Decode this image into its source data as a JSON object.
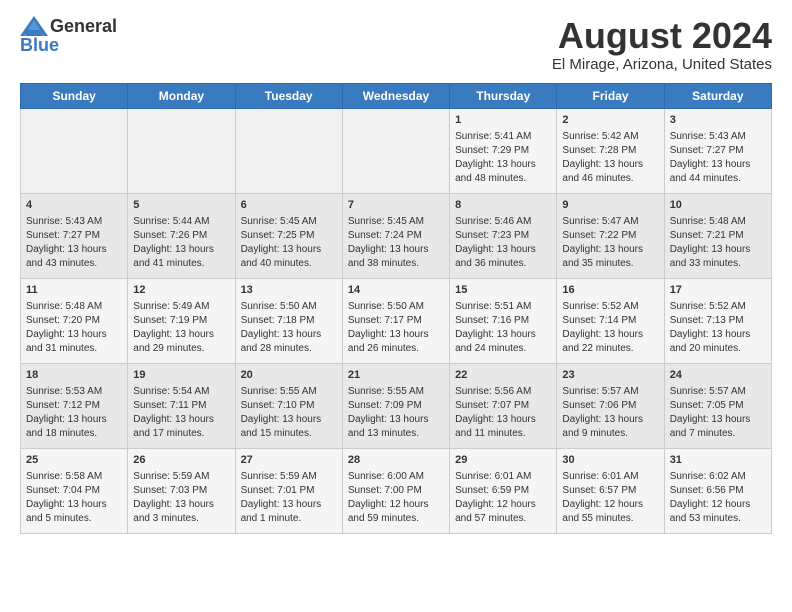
{
  "logo": {
    "general": "General",
    "blue": "Blue"
  },
  "title": "August 2024",
  "location": "El Mirage, Arizona, United States",
  "days_of_week": [
    "Sunday",
    "Monday",
    "Tuesday",
    "Wednesday",
    "Thursday",
    "Friday",
    "Saturday"
  ],
  "weeks": [
    [
      {
        "day": "",
        "sunrise": "",
        "sunset": "",
        "daylight": ""
      },
      {
        "day": "",
        "sunrise": "",
        "sunset": "",
        "daylight": ""
      },
      {
        "day": "",
        "sunrise": "",
        "sunset": "",
        "daylight": ""
      },
      {
        "day": "",
        "sunrise": "",
        "sunset": "",
        "daylight": ""
      },
      {
        "day": "1",
        "sunrise": "Sunrise: 5:41 AM",
        "sunset": "Sunset: 7:29 PM",
        "daylight": "Daylight: 13 hours and 48 minutes."
      },
      {
        "day": "2",
        "sunrise": "Sunrise: 5:42 AM",
        "sunset": "Sunset: 7:28 PM",
        "daylight": "Daylight: 13 hours and 46 minutes."
      },
      {
        "day": "3",
        "sunrise": "Sunrise: 5:43 AM",
        "sunset": "Sunset: 7:27 PM",
        "daylight": "Daylight: 13 hours and 44 minutes."
      }
    ],
    [
      {
        "day": "4",
        "sunrise": "Sunrise: 5:43 AM",
        "sunset": "Sunset: 7:27 PM",
        "daylight": "Daylight: 13 hours and 43 minutes."
      },
      {
        "day": "5",
        "sunrise": "Sunrise: 5:44 AM",
        "sunset": "Sunset: 7:26 PM",
        "daylight": "Daylight: 13 hours and 41 minutes."
      },
      {
        "day": "6",
        "sunrise": "Sunrise: 5:45 AM",
        "sunset": "Sunset: 7:25 PM",
        "daylight": "Daylight: 13 hours and 40 minutes."
      },
      {
        "day": "7",
        "sunrise": "Sunrise: 5:45 AM",
        "sunset": "Sunset: 7:24 PM",
        "daylight": "Daylight: 13 hours and 38 minutes."
      },
      {
        "day": "8",
        "sunrise": "Sunrise: 5:46 AM",
        "sunset": "Sunset: 7:23 PM",
        "daylight": "Daylight: 13 hours and 36 minutes."
      },
      {
        "day": "9",
        "sunrise": "Sunrise: 5:47 AM",
        "sunset": "Sunset: 7:22 PM",
        "daylight": "Daylight: 13 hours and 35 minutes."
      },
      {
        "day": "10",
        "sunrise": "Sunrise: 5:48 AM",
        "sunset": "Sunset: 7:21 PM",
        "daylight": "Daylight: 13 hours and 33 minutes."
      }
    ],
    [
      {
        "day": "11",
        "sunrise": "Sunrise: 5:48 AM",
        "sunset": "Sunset: 7:20 PM",
        "daylight": "Daylight: 13 hours and 31 minutes."
      },
      {
        "day": "12",
        "sunrise": "Sunrise: 5:49 AM",
        "sunset": "Sunset: 7:19 PM",
        "daylight": "Daylight: 13 hours and 29 minutes."
      },
      {
        "day": "13",
        "sunrise": "Sunrise: 5:50 AM",
        "sunset": "Sunset: 7:18 PM",
        "daylight": "Daylight: 13 hours and 28 minutes."
      },
      {
        "day": "14",
        "sunrise": "Sunrise: 5:50 AM",
        "sunset": "Sunset: 7:17 PM",
        "daylight": "Daylight: 13 hours and 26 minutes."
      },
      {
        "day": "15",
        "sunrise": "Sunrise: 5:51 AM",
        "sunset": "Sunset: 7:16 PM",
        "daylight": "Daylight: 13 hours and 24 minutes."
      },
      {
        "day": "16",
        "sunrise": "Sunrise: 5:52 AM",
        "sunset": "Sunset: 7:14 PM",
        "daylight": "Daylight: 13 hours and 22 minutes."
      },
      {
        "day": "17",
        "sunrise": "Sunrise: 5:52 AM",
        "sunset": "Sunset: 7:13 PM",
        "daylight": "Daylight: 13 hours and 20 minutes."
      }
    ],
    [
      {
        "day": "18",
        "sunrise": "Sunrise: 5:53 AM",
        "sunset": "Sunset: 7:12 PM",
        "daylight": "Daylight: 13 hours and 18 minutes."
      },
      {
        "day": "19",
        "sunrise": "Sunrise: 5:54 AM",
        "sunset": "Sunset: 7:11 PM",
        "daylight": "Daylight: 13 hours and 17 minutes."
      },
      {
        "day": "20",
        "sunrise": "Sunrise: 5:55 AM",
        "sunset": "Sunset: 7:10 PM",
        "daylight": "Daylight: 13 hours and 15 minutes."
      },
      {
        "day": "21",
        "sunrise": "Sunrise: 5:55 AM",
        "sunset": "Sunset: 7:09 PM",
        "daylight": "Daylight: 13 hours and 13 minutes."
      },
      {
        "day": "22",
        "sunrise": "Sunrise: 5:56 AM",
        "sunset": "Sunset: 7:07 PM",
        "daylight": "Daylight: 13 hours and 11 minutes."
      },
      {
        "day": "23",
        "sunrise": "Sunrise: 5:57 AM",
        "sunset": "Sunset: 7:06 PM",
        "daylight": "Daylight: 13 hours and 9 minutes."
      },
      {
        "day": "24",
        "sunrise": "Sunrise: 5:57 AM",
        "sunset": "Sunset: 7:05 PM",
        "daylight": "Daylight: 13 hours and 7 minutes."
      }
    ],
    [
      {
        "day": "25",
        "sunrise": "Sunrise: 5:58 AM",
        "sunset": "Sunset: 7:04 PM",
        "daylight": "Daylight: 13 hours and 5 minutes."
      },
      {
        "day": "26",
        "sunrise": "Sunrise: 5:59 AM",
        "sunset": "Sunset: 7:03 PM",
        "daylight": "Daylight: 13 hours and 3 minutes."
      },
      {
        "day": "27",
        "sunrise": "Sunrise: 5:59 AM",
        "sunset": "Sunset: 7:01 PM",
        "daylight": "Daylight: 13 hours and 1 minute."
      },
      {
        "day": "28",
        "sunrise": "Sunrise: 6:00 AM",
        "sunset": "Sunset: 7:00 PM",
        "daylight": "Daylight: 12 hours and 59 minutes."
      },
      {
        "day": "29",
        "sunrise": "Sunrise: 6:01 AM",
        "sunset": "Sunset: 6:59 PM",
        "daylight": "Daylight: 12 hours and 57 minutes."
      },
      {
        "day": "30",
        "sunrise": "Sunrise: 6:01 AM",
        "sunset": "Sunset: 6:57 PM",
        "daylight": "Daylight: 12 hours and 55 minutes."
      },
      {
        "day": "31",
        "sunrise": "Sunrise: 6:02 AM",
        "sunset": "Sunset: 6:56 PM",
        "daylight": "Daylight: 12 hours and 53 minutes."
      }
    ]
  ]
}
